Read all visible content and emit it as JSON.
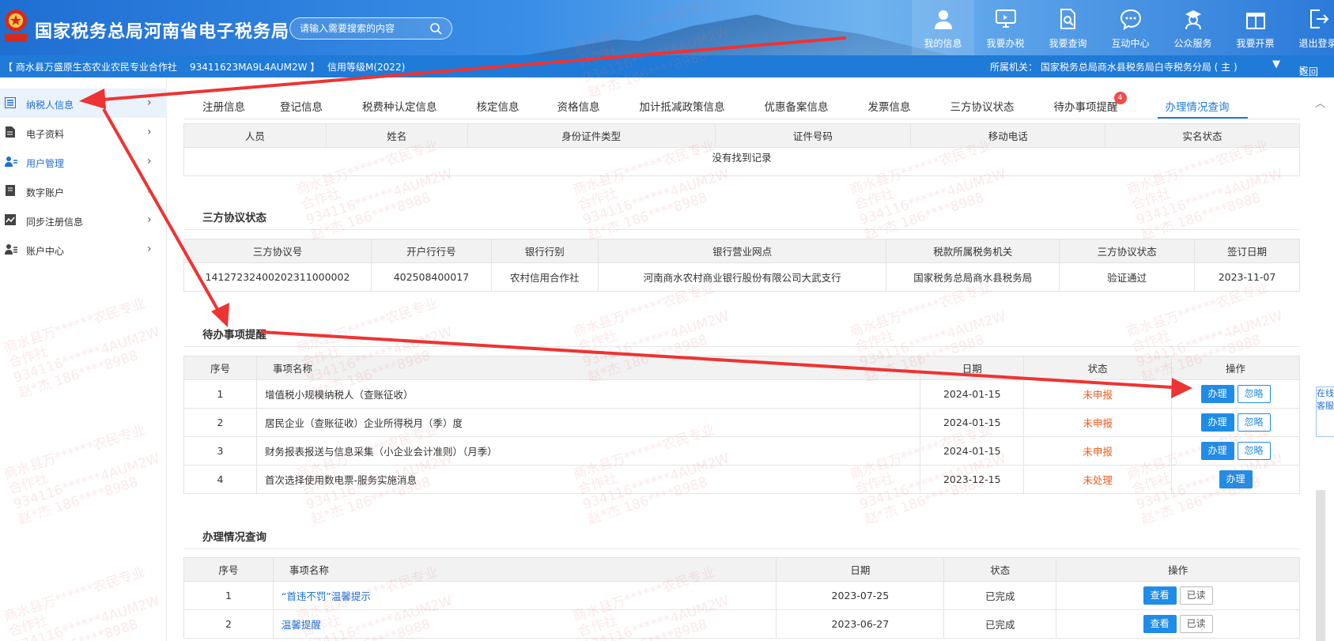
{
  "header": {
    "site_title": "国家税务总局河南省电子税务局",
    "search_placeholder": "请输入需要搜索的内容",
    "nav": [
      {
        "label": "我的信息",
        "icon": "user-icon"
      },
      {
        "label": "我要办税",
        "icon": "monitor-icon"
      },
      {
        "label": "我要查询",
        "icon": "document-search-icon"
      },
      {
        "label": "互动中心",
        "icon": "chat-icon"
      },
      {
        "label": "公众服务",
        "icon": "person-cap-icon"
      },
      {
        "label": "我要开票",
        "icon": "gift-box-icon"
      },
      {
        "label": "退出登录",
        "icon": "logout-icon"
      }
    ]
  },
  "infobar": {
    "taxpayer": "【 商水县万盛原生态农业农民专业合作社",
    "tax_id": "93411623MA9L4AUM2W 】",
    "credit": "信用等级M(2022)",
    "authority": "所属机关：  国家税务总局商水县税务局白寺税务分局 ( 主 )",
    "back": "返回"
  },
  "sidebar": [
    {
      "label": "纳税人信息",
      "icon": "list-icon"
    },
    {
      "label": "电子资料",
      "icon": "file-icon"
    },
    {
      "label": "用户管理",
      "icon": "users-icon"
    },
    {
      "label": "数字账户",
      "icon": "book-icon"
    },
    {
      "label": "同步注册信息",
      "icon": "chart-line-icon"
    },
    {
      "label": "账户中心",
      "icon": "user-gear-icon"
    }
  ],
  "tabs": [
    "注册信息",
    "登记信息",
    "税费种认定信息",
    "核定信息",
    "资格信息",
    "加计抵减政策信息",
    "优惠备案信息",
    "发票信息",
    "三方协议状态",
    "待办事项提醒",
    "办理情况查询"
  ],
  "tab_badge": "4",
  "personnel": {
    "headers": [
      "人员",
      "姓名",
      "身份证件类型",
      "证件号码",
      "移动电话",
      "实名状态"
    ],
    "empty": "没有找到记录"
  },
  "agreement": {
    "title": "三方协议状态",
    "headers": [
      "三方协议号",
      "开户行行号",
      "银行行别",
      "银行营业网点",
      "税款所属税务机关",
      "三方协议状态",
      "签订日期"
    ],
    "rows": [
      [
        "14127232400202311000002",
        "402508400017",
        "农村信用合作社",
        "河南商水农村商业银行股份有限公司大武支行",
        "国家税务总局商水县税务局",
        "验证通过",
        "2023-11-07"
      ]
    ]
  },
  "todo": {
    "title": "待办事项提醒",
    "headers": [
      "序号",
      "事项名称",
      "日期",
      "状态",
      "操作"
    ],
    "rows": [
      [
        "1",
        "增值税小规模纳税人（查账征收）",
        "2024-01-15",
        "未申报"
      ],
      [
        "2",
        "居民企业（查账征收）企业所得税月（季）度",
        "2024-01-15",
        "未申报"
      ],
      [
        "3",
        "财务报表报送与信息采集（小企业会计准则）（月季）",
        "2024-01-15",
        "未申报"
      ],
      [
        "4",
        "首次选择使用数电票-服务实施消息",
        "2023-12-15",
        "未处理"
      ]
    ],
    "handle_label": "办理",
    "ignore_label": "忽略"
  },
  "history": {
    "title": "办理情况查询",
    "headers": [
      "序号",
      "事项名称",
      "日期",
      "状态",
      "操作"
    ],
    "rows": [
      [
        "1",
        "“首违不罚”温馨提示",
        "2023-07-25",
        "已完成"
      ],
      [
        "2",
        "温馨提醒",
        "2023-06-27",
        "已完成"
      ]
    ],
    "view_label": "查看",
    "read_label": "已读"
  },
  "watermark": [
    "商水县万******农民专业",
    "合作社",
    "934116******4AUM2W",
    "赵*杰 186****8988"
  ],
  "kefu": "在线客服",
  "colors": {
    "header": "#2b7ad9",
    "infobar": "#1f7ad8",
    "accent": "#1f8ce8",
    "status_red": "#f05a1b",
    "annotation": "#ee3333"
  }
}
